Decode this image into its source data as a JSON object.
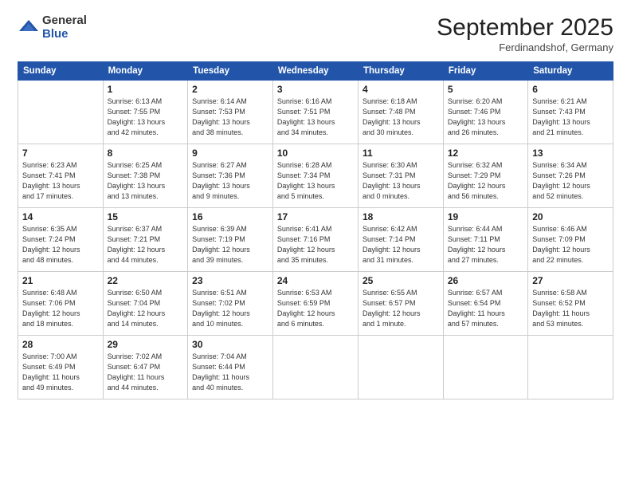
{
  "logo": {
    "general": "General",
    "blue": "Blue"
  },
  "header": {
    "month": "September 2025",
    "location": "Ferdinandshof, Germany"
  },
  "weekdays": [
    "Sunday",
    "Monday",
    "Tuesday",
    "Wednesday",
    "Thursday",
    "Friday",
    "Saturday"
  ],
  "weeks": [
    [
      {
        "day": "",
        "info": ""
      },
      {
        "day": "1",
        "info": "Sunrise: 6:13 AM\nSunset: 7:55 PM\nDaylight: 13 hours\nand 42 minutes."
      },
      {
        "day": "2",
        "info": "Sunrise: 6:14 AM\nSunset: 7:53 PM\nDaylight: 13 hours\nand 38 minutes."
      },
      {
        "day": "3",
        "info": "Sunrise: 6:16 AM\nSunset: 7:51 PM\nDaylight: 13 hours\nand 34 minutes."
      },
      {
        "day": "4",
        "info": "Sunrise: 6:18 AM\nSunset: 7:48 PM\nDaylight: 13 hours\nand 30 minutes."
      },
      {
        "day": "5",
        "info": "Sunrise: 6:20 AM\nSunset: 7:46 PM\nDaylight: 13 hours\nand 26 minutes."
      },
      {
        "day": "6",
        "info": "Sunrise: 6:21 AM\nSunset: 7:43 PM\nDaylight: 13 hours\nand 21 minutes."
      }
    ],
    [
      {
        "day": "7",
        "info": "Sunrise: 6:23 AM\nSunset: 7:41 PM\nDaylight: 13 hours\nand 17 minutes."
      },
      {
        "day": "8",
        "info": "Sunrise: 6:25 AM\nSunset: 7:38 PM\nDaylight: 13 hours\nand 13 minutes."
      },
      {
        "day": "9",
        "info": "Sunrise: 6:27 AM\nSunset: 7:36 PM\nDaylight: 13 hours\nand 9 minutes."
      },
      {
        "day": "10",
        "info": "Sunrise: 6:28 AM\nSunset: 7:34 PM\nDaylight: 13 hours\nand 5 minutes."
      },
      {
        "day": "11",
        "info": "Sunrise: 6:30 AM\nSunset: 7:31 PM\nDaylight: 13 hours\nand 0 minutes."
      },
      {
        "day": "12",
        "info": "Sunrise: 6:32 AM\nSunset: 7:29 PM\nDaylight: 12 hours\nand 56 minutes."
      },
      {
        "day": "13",
        "info": "Sunrise: 6:34 AM\nSunset: 7:26 PM\nDaylight: 12 hours\nand 52 minutes."
      }
    ],
    [
      {
        "day": "14",
        "info": "Sunrise: 6:35 AM\nSunset: 7:24 PM\nDaylight: 12 hours\nand 48 minutes."
      },
      {
        "day": "15",
        "info": "Sunrise: 6:37 AM\nSunset: 7:21 PM\nDaylight: 12 hours\nand 44 minutes."
      },
      {
        "day": "16",
        "info": "Sunrise: 6:39 AM\nSunset: 7:19 PM\nDaylight: 12 hours\nand 39 minutes."
      },
      {
        "day": "17",
        "info": "Sunrise: 6:41 AM\nSunset: 7:16 PM\nDaylight: 12 hours\nand 35 minutes."
      },
      {
        "day": "18",
        "info": "Sunrise: 6:42 AM\nSunset: 7:14 PM\nDaylight: 12 hours\nand 31 minutes."
      },
      {
        "day": "19",
        "info": "Sunrise: 6:44 AM\nSunset: 7:11 PM\nDaylight: 12 hours\nand 27 minutes."
      },
      {
        "day": "20",
        "info": "Sunrise: 6:46 AM\nSunset: 7:09 PM\nDaylight: 12 hours\nand 22 minutes."
      }
    ],
    [
      {
        "day": "21",
        "info": "Sunrise: 6:48 AM\nSunset: 7:06 PM\nDaylight: 12 hours\nand 18 minutes."
      },
      {
        "day": "22",
        "info": "Sunrise: 6:50 AM\nSunset: 7:04 PM\nDaylight: 12 hours\nand 14 minutes."
      },
      {
        "day": "23",
        "info": "Sunrise: 6:51 AM\nSunset: 7:02 PM\nDaylight: 12 hours\nand 10 minutes."
      },
      {
        "day": "24",
        "info": "Sunrise: 6:53 AM\nSunset: 6:59 PM\nDaylight: 12 hours\nand 6 minutes."
      },
      {
        "day": "25",
        "info": "Sunrise: 6:55 AM\nSunset: 6:57 PM\nDaylight: 12 hours\nand 1 minute."
      },
      {
        "day": "26",
        "info": "Sunrise: 6:57 AM\nSunset: 6:54 PM\nDaylight: 11 hours\nand 57 minutes."
      },
      {
        "day": "27",
        "info": "Sunrise: 6:58 AM\nSunset: 6:52 PM\nDaylight: 11 hours\nand 53 minutes."
      }
    ],
    [
      {
        "day": "28",
        "info": "Sunrise: 7:00 AM\nSunset: 6:49 PM\nDaylight: 11 hours\nand 49 minutes."
      },
      {
        "day": "29",
        "info": "Sunrise: 7:02 AM\nSunset: 6:47 PM\nDaylight: 11 hours\nand 44 minutes."
      },
      {
        "day": "30",
        "info": "Sunrise: 7:04 AM\nSunset: 6:44 PM\nDaylight: 11 hours\nand 40 minutes."
      },
      {
        "day": "",
        "info": ""
      },
      {
        "day": "",
        "info": ""
      },
      {
        "day": "",
        "info": ""
      },
      {
        "day": "",
        "info": ""
      }
    ]
  ]
}
